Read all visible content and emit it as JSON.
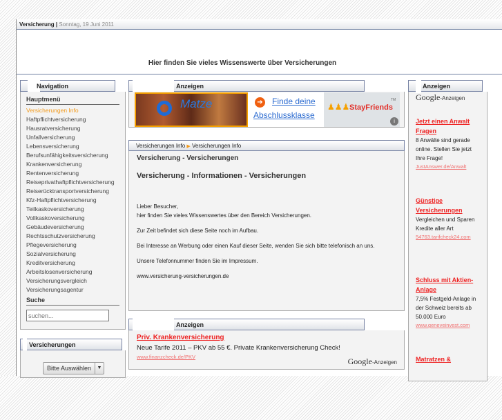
{
  "header": {
    "site": "Versicherung",
    "sep": "|",
    "date": "Sonntag, 19 Juni 2011",
    "slogan": "Hier finden Sie vieles Wissenswerte über Versicherungen"
  },
  "nav": {
    "title": "Navigation",
    "menu_title": "Hauptmenü",
    "items": [
      "Versicherungen Info",
      "Haftpflichtversicherung",
      "Hausratversicherung",
      "Unfallversicherung",
      "Lebensversicherung",
      "Berufsunfähigkeitsversicherung",
      "Krankenversicherung",
      "Rentenversicherung",
      "Reiseprivathaftpflichtversicherung",
      "Reiserücktransportversicherung",
      "Kfz-Haftpflichtversicherung",
      "Teilkaskoversicherung",
      "Vollkaskoversicherung",
      "Gebäudeversicherung",
      "Rechtsschutzversicherung",
      "Pflegeversicherung",
      "Sozialversicherung",
      "Kreditversicherung",
      "Arbeitslosenversicherung",
      "Versicherungsvergleich",
      "Versicherungsagentur"
    ],
    "search_title": "Suche",
    "search_placeholder": "suchen..."
  },
  "versicherungen": {
    "title": "Versicherungen",
    "select": "Bitte Auswählen"
  },
  "banner": {
    "title": "Anzeigen",
    "logo": "Matze",
    "link1": "Finde deine",
    "link2": "Abschlussklasse",
    "brand": "StayFriends",
    "tm": "TM"
  },
  "breadcrumb": [
    "Versicherungen Info",
    "Versicherungen Info"
  ],
  "content": {
    "h1": "Versicherung - Versicherungen",
    "h2": "Versicherung - Informationen - Versicherungen",
    "p1a": "Lieber Besucher,",
    "p1b": "hier finden Sie vieles Wissenswertes über den Bereich Versicherungen.",
    "p2": "Zur Zeit befindet sich diese Seite noch im Aufbau.",
    "p3": "Bei Interesse an Werbung oder einen Kauf dieser Seite, wenden Sie sich bitte telefonisch an uns.",
    "p4": "Unsere Telefonnummer finden Sie im Impressum.",
    "p5": "www.versicherung-versicherungen.de"
  },
  "bottom_ad": {
    "title": "Anzeigen",
    "headline": "Priv. Krankenversicherung",
    "body": "Neue Tarife 2011 – PKV ab 55 €. Private Krankenversicherung Check!",
    "url": "www.finanzcheck.de/PKV",
    "google": "Google",
    "google_suffix": "-Anzeigen"
  },
  "right_ads": {
    "title": "Anzeigen",
    "google": "Google",
    "google_suffix": "-Anzeigen",
    "ads": [
      {
        "headline": "Jetzt einen Anwalt Fragen",
        "body": "8 Anwälte sind gerade online. Stellen Sie jetzt Ihre Frage!",
        "url": "JustAnswer.de/Anwalt"
      },
      {
        "headline": "Günstige Versicherungen",
        "body": "Vergleichen und Sparen Kredite aller Art",
        "url": "54763.tarifcheck24.com"
      },
      {
        "headline": "Schluss mit Aktien-Anlage",
        "body": "7,5% Festgeld-Anlage in der Schweiz bereits ab 50.000 Euro",
        "url": "www.geneveinvest.com"
      },
      {
        "headline": "Matratzen &",
        "body": "",
        "url": ""
      }
    ]
  }
}
